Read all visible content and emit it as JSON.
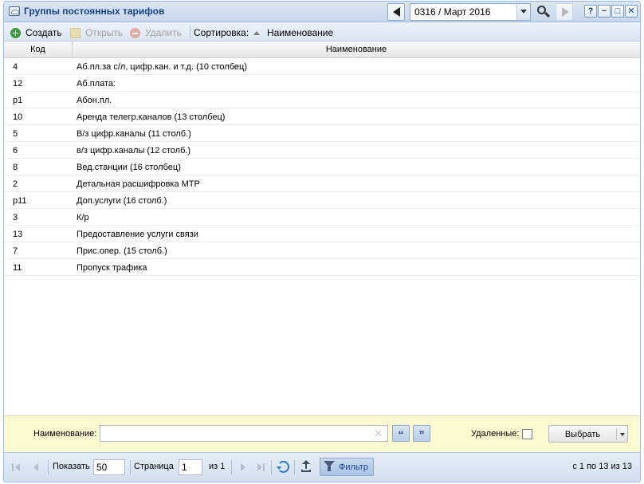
{
  "window": {
    "title": "Группы постоянных тарифов",
    "period_value": "0316 / Март 2016",
    "tools": {
      "help": "?",
      "minimize": "−",
      "maximize": "□",
      "close": "✕"
    }
  },
  "toolbar": {
    "create_label": "Создать",
    "open_label": "Открыть",
    "delete_label": "Удалить",
    "sort_label": "Сортировка:",
    "sort_field": "Наименование"
  },
  "grid": {
    "columns": {
      "code": "Код",
      "name": "Наименование"
    },
    "rows": [
      {
        "code": "4",
        "name": "Аб.пл.за с/л, цифр.кан. и т.д. (10 столбец)"
      },
      {
        "code": "12",
        "name": "Аб.плата:"
      },
      {
        "code": "p1",
        "name": "Абон.пл."
      },
      {
        "code": "10",
        "name": "Аренда телегр.каналов (13 столбец)"
      },
      {
        "code": "5",
        "name": "В/з цифр.каналы (11 столб.)"
      },
      {
        "code": "6",
        "name": "в/з цифр.каналы (12 столб.)"
      },
      {
        "code": "8",
        "name": "Вед.станции (16 столбец)"
      },
      {
        "code": "2",
        "name": "Детальная расшифровка МТР"
      },
      {
        "code": "p11",
        "name": "Доп.услуги (16 столб.)"
      },
      {
        "code": "3",
        "name": "К/р"
      },
      {
        "code": "13",
        "name": "Предоставление услуги связи"
      },
      {
        "code": "7",
        "name": "Прис.опер. (15 столб.)"
      },
      {
        "code": "11",
        "name": "Пропуск трафика"
      }
    ]
  },
  "filter": {
    "name_label": "Наименование:",
    "name_value": "",
    "clear_glyph": "✕",
    "open_quote": "“",
    "close_quote": "”",
    "deleted_label": "Удаленные:",
    "deleted_checked": false,
    "select_label": "Выбрать"
  },
  "paging": {
    "show_label": "Показать",
    "page_size": "50",
    "page_label": "Страница",
    "page_value": "1",
    "of_label": "из 1",
    "filter_label": "Фильтр",
    "summary": "с 1 по 13 из 13"
  },
  "icons": {
    "title": "window-icon",
    "prev_period": "arrow-left-icon",
    "next_period": "arrow-right-icon",
    "search": "magnifier-icon",
    "create": "plus-circle-icon",
    "open": "folder-icon",
    "delete": "minus-circle-icon",
    "refresh": "refresh-icon",
    "export": "export-icon",
    "filter": "funnel-icon"
  },
  "colors": {
    "title_text": "#15428b",
    "panel_border": "#99bbe8",
    "filter_panel_bg": "#fbf9cf",
    "create_icon": "#3e9b3c"
  }
}
